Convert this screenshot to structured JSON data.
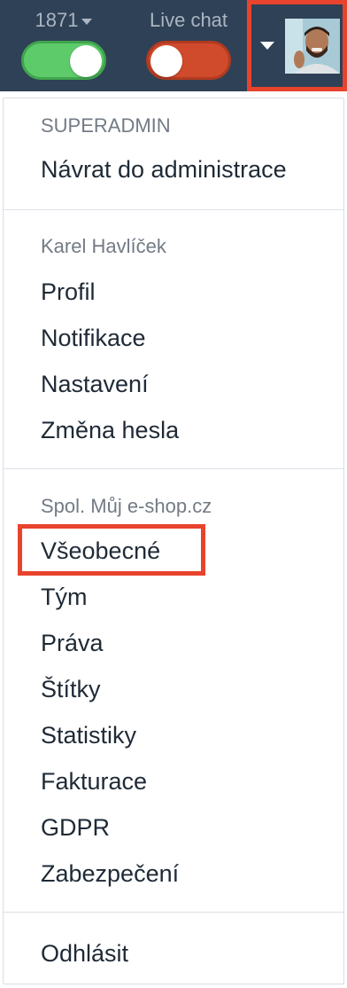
{
  "topbar": {
    "counter_label": "1871",
    "counter_toggle_state": "on",
    "livechat_label": "Live chat",
    "livechat_toggle_state": "off"
  },
  "menu": {
    "superadmin_header": "SUPERADMIN",
    "back_to_admin": "Návrat do administrace",
    "user_header": "Karel Havlíček",
    "user_items": [
      "Profil",
      "Notifikace",
      "Nastavení",
      "Změna hesla"
    ],
    "company_header": "Spol. Můj e-shop.cz",
    "company_items": [
      "Všeobecné",
      "Tým",
      "Práva",
      "Štítky",
      "Statistiky",
      "Fakturace",
      "GDPR",
      "Zabezpečení"
    ],
    "logout": "Odhlásit"
  },
  "colors": {
    "topbar_bg": "#2f4156",
    "toggle_on": "#5ecb6a",
    "toggle_off": "#d04a2c",
    "highlight": "#e8432d"
  }
}
